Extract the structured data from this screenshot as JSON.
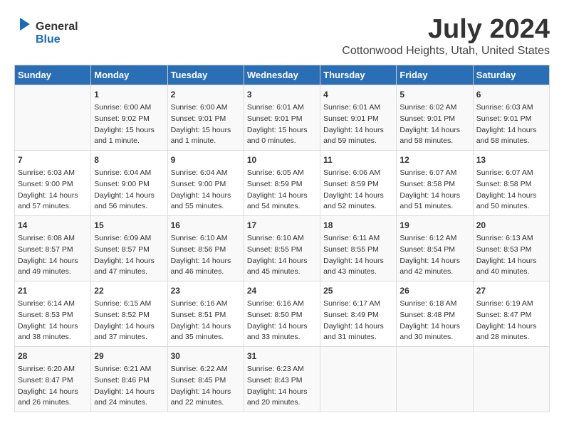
{
  "header": {
    "logo_general": "General",
    "logo_blue": "Blue",
    "title": "July 2024",
    "subtitle": "Cottonwood Heights, Utah, United States"
  },
  "days_of_week": [
    "Sunday",
    "Monday",
    "Tuesday",
    "Wednesday",
    "Thursday",
    "Friday",
    "Saturday"
  ],
  "weeks": [
    [
      {
        "day": "",
        "info": ""
      },
      {
        "day": "1",
        "info": "Sunrise: 6:00 AM\nSunset: 9:02 PM\nDaylight: 15 hours\nand 1 minute."
      },
      {
        "day": "2",
        "info": "Sunrise: 6:00 AM\nSunset: 9:01 PM\nDaylight: 15 hours\nand 1 minute."
      },
      {
        "day": "3",
        "info": "Sunrise: 6:01 AM\nSunset: 9:01 PM\nDaylight: 15 hours\nand 0 minutes."
      },
      {
        "day": "4",
        "info": "Sunrise: 6:01 AM\nSunset: 9:01 PM\nDaylight: 14 hours\nand 59 minutes."
      },
      {
        "day": "5",
        "info": "Sunrise: 6:02 AM\nSunset: 9:01 PM\nDaylight: 14 hours\nand 58 minutes."
      },
      {
        "day": "6",
        "info": "Sunrise: 6:03 AM\nSunset: 9:01 PM\nDaylight: 14 hours\nand 58 minutes."
      }
    ],
    [
      {
        "day": "7",
        "info": "Sunrise: 6:03 AM\nSunset: 9:00 PM\nDaylight: 14 hours\nand 57 minutes."
      },
      {
        "day": "8",
        "info": "Sunrise: 6:04 AM\nSunset: 9:00 PM\nDaylight: 14 hours\nand 56 minutes."
      },
      {
        "day": "9",
        "info": "Sunrise: 6:04 AM\nSunset: 9:00 PM\nDaylight: 14 hours\nand 55 minutes."
      },
      {
        "day": "10",
        "info": "Sunrise: 6:05 AM\nSunset: 8:59 PM\nDaylight: 14 hours\nand 54 minutes."
      },
      {
        "day": "11",
        "info": "Sunrise: 6:06 AM\nSunset: 8:59 PM\nDaylight: 14 hours\nand 52 minutes."
      },
      {
        "day": "12",
        "info": "Sunrise: 6:07 AM\nSunset: 8:58 PM\nDaylight: 14 hours\nand 51 minutes."
      },
      {
        "day": "13",
        "info": "Sunrise: 6:07 AM\nSunset: 8:58 PM\nDaylight: 14 hours\nand 50 minutes."
      }
    ],
    [
      {
        "day": "14",
        "info": "Sunrise: 6:08 AM\nSunset: 8:57 PM\nDaylight: 14 hours\nand 49 minutes."
      },
      {
        "day": "15",
        "info": "Sunrise: 6:09 AM\nSunset: 8:57 PM\nDaylight: 14 hours\nand 47 minutes."
      },
      {
        "day": "16",
        "info": "Sunrise: 6:10 AM\nSunset: 8:56 PM\nDaylight: 14 hours\nand 46 minutes."
      },
      {
        "day": "17",
        "info": "Sunrise: 6:10 AM\nSunset: 8:55 PM\nDaylight: 14 hours\nand 45 minutes."
      },
      {
        "day": "18",
        "info": "Sunrise: 6:11 AM\nSunset: 8:55 PM\nDaylight: 14 hours\nand 43 minutes."
      },
      {
        "day": "19",
        "info": "Sunrise: 6:12 AM\nSunset: 8:54 PM\nDaylight: 14 hours\nand 42 minutes."
      },
      {
        "day": "20",
        "info": "Sunrise: 6:13 AM\nSunset: 8:53 PM\nDaylight: 14 hours\nand 40 minutes."
      }
    ],
    [
      {
        "day": "21",
        "info": "Sunrise: 6:14 AM\nSunset: 8:53 PM\nDaylight: 14 hours\nand 38 minutes."
      },
      {
        "day": "22",
        "info": "Sunrise: 6:15 AM\nSunset: 8:52 PM\nDaylight: 14 hours\nand 37 minutes."
      },
      {
        "day": "23",
        "info": "Sunrise: 6:16 AM\nSunset: 8:51 PM\nDaylight: 14 hours\nand 35 minutes."
      },
      {
        "day": "24",
        "info": "Sunrise: 6:16 AM\nSunset: 8:50 PM\nDaylight: 14 hours\nand 33 minutes."
      },
      {
        "day": "25",
        "info": "Sunrise: 6:17 AM\nSunset: 8:49 PM\nDaylight: 14 hours\nand 31 minutes."
      },
      {
        "day": "26",
        "info": "Sunrise: 6:18 AM\nSunset: 8:48 PM\nDaylight: 14 hours\nand 30 minutes."
      },
      {
        "day": "27",
        "info": "Sunrise: 6:19 AM\nSunset: 8:47 PM\nDaylight: 14 hours\nand 28 minutes."
      }
    ],
    [
      {
        "day": "28",
        "info": "Sunrise: 6:20 AM\nSunset: 8:47 PM\nDaylight: 14 hours\nand 26 minutes."
      },
      {
        "day": "29",
        "info": "Sunrise: 6:21 AM\nSunset: 8:46 PM\nDaylight: 14 hours\nand 24 minutes."
      },
      {
        "day": "30",
        "info": "Sunrise: 6:22 AM\nSunset: 8:45 PM\nDaylight: 14 hours\nand 22 minutes."
      },
      {
        "day": "31",
        "info": "Sunrise: 6:23 AM\nSunset: 8:43 PM\nDaylight: 14 hours\nand 20 minutes."
      },
      {
        "day": "",
        "info": ""
      },
      {
        "day": "",
        "info": ""
      },
      {
        "day": "",
        "info": ""
      }
    ]
  ]
}
